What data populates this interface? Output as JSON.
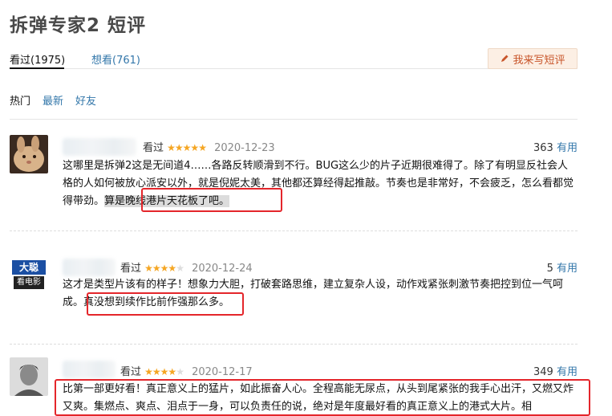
{
  "page": {
    "title": "拆弹专家2 短评"
  },
  "tabs": {
    "watched": "看过(1975)",
    "want": "想看(761)"
  },
  "write_button": {
    "label": "我来写短评",
    "icon": "pencil-icon",
    "color": "#c8552a"
  },
  "filters": {
    "hot": "热门",
    "latest": "最新",
    "friends": "好友"
  },
  "reviews": [
    {
      "seen": "看过",
      "stars": 5,
      "stars_text": "★★★★★",
      "date": "2020-12-23",
      "votes": "363",
      "useful": "有用",
      "text_main": "这哪里是拆弹2这是无间道4……各路反转顺滑到不行。BUG这么少的片子近期很难得了。除了有明显反社会人格的人如何被放心派安以外，就是倪妮太美，其他都还算经得起推敲。节奏也是非常好，不会疲乏，怎么看都觉得带劲。",
      "text_highlight": "算是晚线港片天花板了吧。",
      "avatar": "rabbit-avatar"
    },
    {
      "seen": "看过",
      "stars": 4,
      "stars_text": "★★★★",
      "stars_off": "★",
      "date": "2020-12-24",
      "votes": "5",
      "useful": "有用",
      "text_main": "这才是类型片该有的样子！想象力大胆，打破套路思维，建立复杂人设，动作戏紧张刺激节奏把控到位一气呵成。",
      "text_highlight": "真没想到续作比前作强那么多。",
      "avatar": "daqing-movie-avatar",
      "avatar_line1": "大聪",
      "avatar_line2": "看电影"
    },
    {
      "seen": "看过",
      "stars": 4,
      "stars_text": "★★★★",
      "stars_off": "★",
      "date": "2020-12-17",
      "votes": "349",
      "useful": "有用",
      "text_main": "比第一部更好看！真正意义上的猛片，如此振奋人心。全程高能无尿点，从头到尾紧张的我手心出汗，又燃又炸又爽。集燃点、爽点、泪点于一身，可以负责任的说，绝对是年度最好看的真正意义上的港式大片。相",
      "avatar": "man-portrait-avatar"
    }
  ],
  "colors": {
    "link": "#3377aa",
    "star": "#f5a623",
    "annotation": "#e4262b"
  }
}
